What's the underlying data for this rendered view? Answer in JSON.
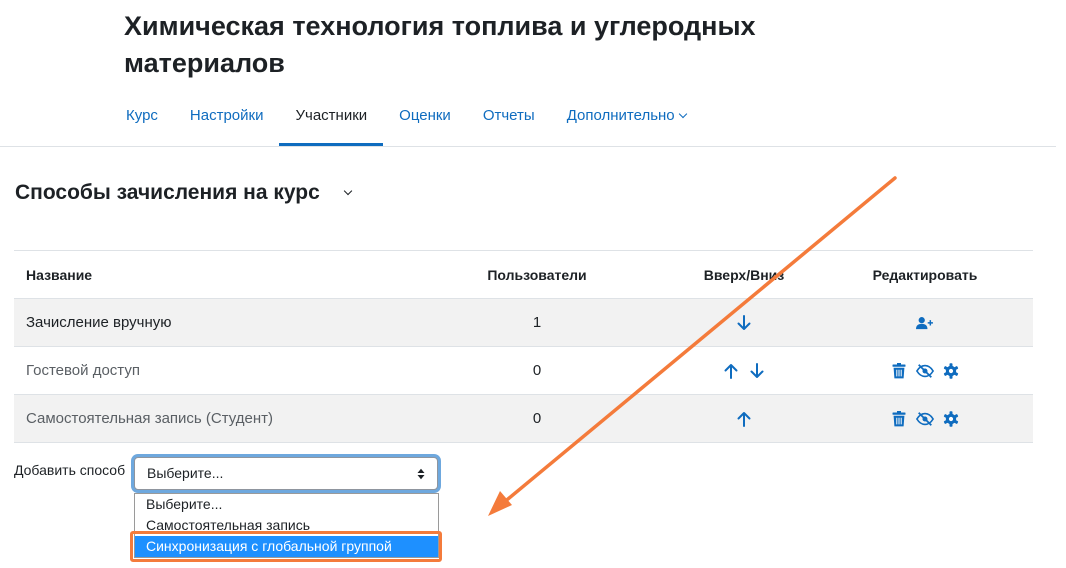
{
  "course": {
    "title": "Химическая технология топлива и углеродных материалов"
  },
  "nav": {
    "items": [
      {
        "label": "Курс"
      },
      {
        "label": "Настройки"
      },
      {
        "label": "Участники"
      },
      {
        "label": "Оценки"
      },
      {
        "label": "Отчеты"
      },
      {
        "label": "Дополнительно"
      }
    ],
    "active": "Участники"
  },
  "section": {
    "title": "Способы зачисления на курс"
  },
  "table": {
    "headers": {
      "name": "Название",
      "users": "Пользователи",
      "move": "Вверх/Вниз",
      "edit": "Редактировать"
    },
    "rows": [
      {
        "name": "Зачисление вручную",
        "users": "1",
        "move": [
          "arrow-down-icon"
        ],
        "edit": [
          "enrol-users-icon"
        ]
      },
      {
        "name": "Гостевой доступ",
        "users": "0",
        "move": [
          "arrow-up-icon",
          "arrow-down-icon"
        ],
        "edit": [
          "delete-icon",
          "hide-icon",
          "settings-icon"
        ]
      },
      {
        "name": "Самостоятельная запись (Студент)",
        "users": "0",
        "move": [
          "arrow-up-icon"
        ],
        "edit": [
          "delete-icon",
          "hide-icon",
          "settings-icon"
        ]
      }
    ]
  },
  "add_method": {
    "label": "Добавить способ",
    "selected": "Выберите...",
    "options": [
      "Выберите...",
      "Самостоятельная запись",
      "Синхронизация с глобальной группой"
    ],
    "highlighted_option": "Синхронизация с глобальной группой"
  },
  "colors": {
    "link": "#0f6cbf",
    "text": "#1d2125",
    "annotation": "#f47b3b",
    "option_selected": "#1e90ff"
  }
}
